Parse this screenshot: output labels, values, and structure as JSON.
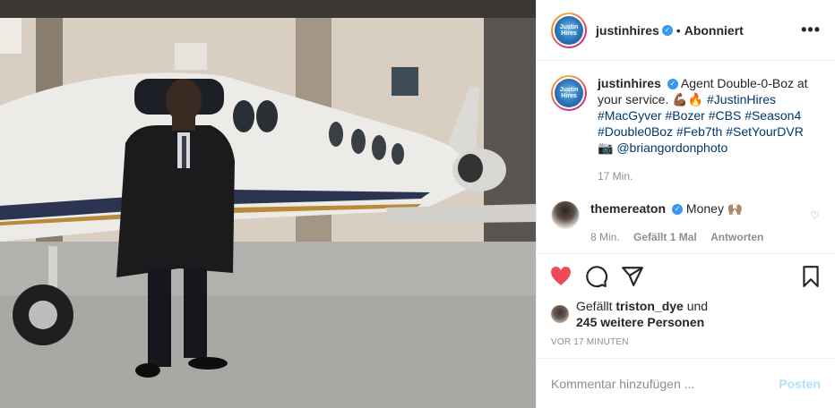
{
  "post": {
    "username": "justinhires",
    "follow_state": "Abonniert",
    "separator": "•",
    "more_label": "•••",
    "avatar_text": "Justin Hires",
    "caption": {
      "text": "Agent Double-0-Boz at your service. 💪🏾🔥",
      "hashtags": [
        "#JustinHires",
        "#MacGyver",
        "#Bozer",
        "#CBS",
        "#Season4",
        "#Double0Boz",
        "#Feb7th",
        "#SetYourDVR"
      ],
      "camera_emoji": "📷",
      "mention": "@briangordonphoto"
    },
    "caption_time": "17 Min.",
    "comment": {
      "username": "themereaton",
      "text": "Money 🙌🏽",
      "time": "8 Min.",
      "likes": "Gefällt 1 Mal",
      "reply": "Antworten"
    },
    "likes": {
      "prefix": "Gefällt",
      "user": "triston_dye",
      "and": "und",
      "others": "245 weitere Personen"
    },
    "timestamp": "VOR 17 MINUTEN",
    "add_comment_placeholder": "Kommentar hinzufügen ...",
    "post_button": "Posten"
  },
  "colors": {
    "like_red": "#ed4956",
    "verified_blue": "#3897f0",
    "link_blue": "#00376b",
    "post_button": "#b2dffc"
  },
  "icons": [
    "heart-icon",
    "comment-icon",
    "share-icon",
    "save-icon",
    "verified-icon",
    "more-icon"
  ]
}
